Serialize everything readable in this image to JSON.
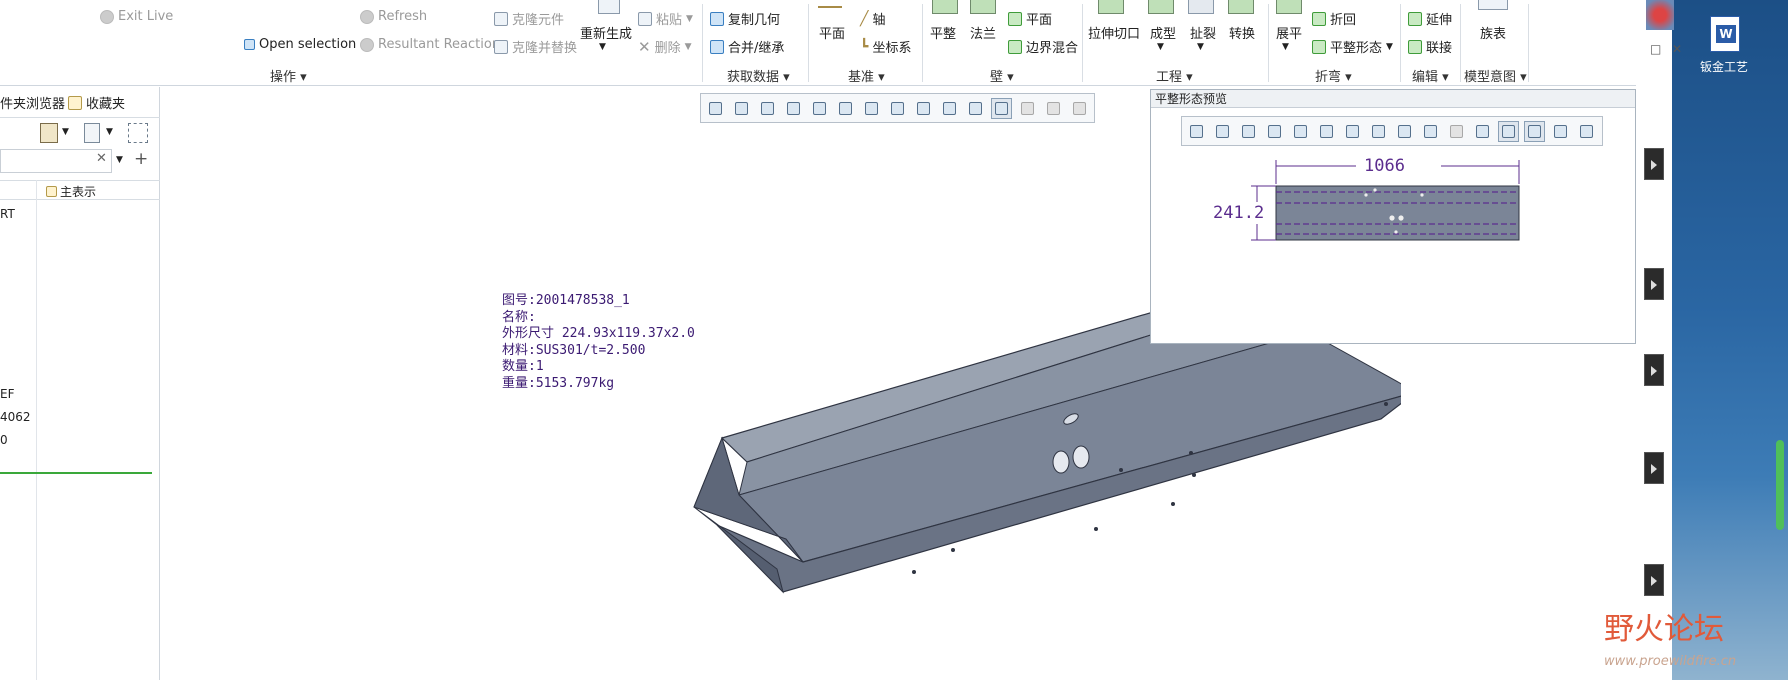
{
  "ribbon": {
    "operations": {
      "exit_live": "Exit Live",
      "refresh": "Refresh",
      "open_selection": "Open selection",
      "resultant_reaction": "Resultant Reaction",
      "clone_component": "克隆元件",
      "clone_replace": "克隆并替换",
      "regenerate": "重新生成",
      "paste": "粘贴",
      "delete": "删除",
      "group_label": "操作"
    },
    "get_data": {
      "copy_geometry": "复制几何",
      "merge_inherit": "合并/继承",
      "group_label": "获取数据"
    },
    "datum": {
      "plane": "平面",
      "axis": "轴",
      "csys": "坐标系",
      "group_label": "基准"
    },
    "wall": {
      "flat": "平整",
      "flange": "法兰",
      "plane": "平面",
      "boundary_blend": "边界混合",
      "group_label": "壁"
    },
    "engineering": {
      "extrude_cut": "拉伸切口",
      "form": "成型",
      "rip": "扯裂",
      "convert": "转换",
      "group_label": "工程"
    },
    "bend": {
      "unbend": "展平",
      "bend_back": "折回",
      "flat_state": "平整形态",
      "group_label": "折弯"
    },
    "edit": {
      "extend": "延伸",
      "join": "联接",
      "group_label": "编辑"
    },
    "model_intent": {
      "family_table": "族表",
      "group_label": "模型意图"
    }
  },
  "left_panel": {
    "tab_folder": "件夹浏览器",
    "tab_favorites": "收藏夹",
    "column_header": "主表示",
    "rows": [
      "RT",
      "EF",
      "4062",
      "0"
    ]
  },
  "part_info": {
    "drawing_no": "图号:2001478538_1",
    "name": "名称:",
    "dims": "外形尺寸 224.93x119.37x2.0",
    "material": "材料:SUS301/t=2.500",
    "qty": "数量:1",
    "weight": "重量:5153.797kg"
  },
  "preview": {
    "title": "平整形态预览",
    "dim_length": "1066",
    "dim_width": "241.2"
  },
  "desktop": {
    "icon_label": "钣金工艺"
  },
  "watermark": {
    "text": "野火论坛",
    "url": "www.proewildfire.cn"
  },
  "colors": {
    "part_fill": "#7b8597",
    "part_edge": "#2f3442",
    "dim_color": "#5b2d8e",
    "accent_green": "#3aa83a"
  }
}
